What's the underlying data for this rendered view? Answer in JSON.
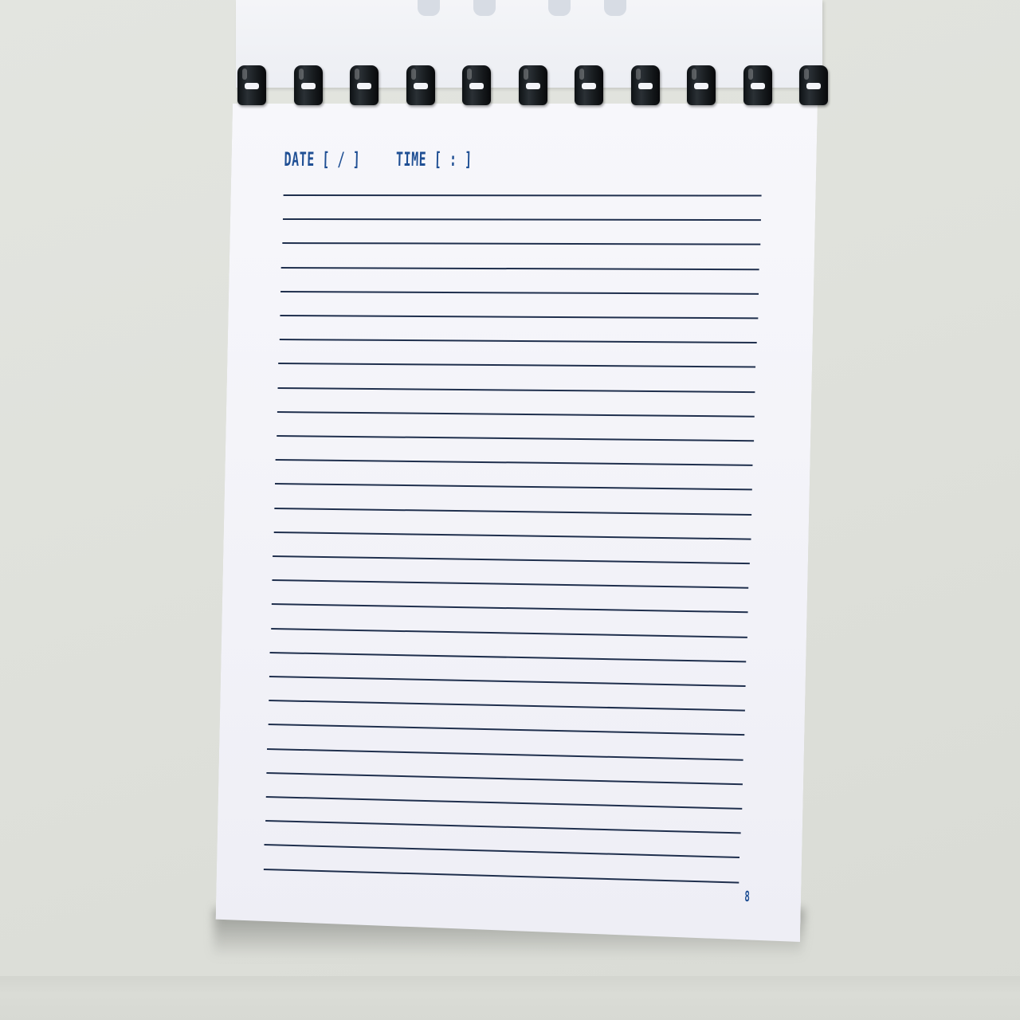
{
  "notebook": {
    "header": {
      "date_label": "DATE",
      "date_brackets": "[ / ]",
      "time_label": "TIME",
      "time_brackets": "[ : ]"
    },
    "page_number": "8",
    "ruled_line_count": 29,
    "binding_ring_count": 11
  },
  "colors": {
    "ink_blue": "#1f4f94",
    "rule_navy": "#1f2f4d",
    "binding_black": "#111417",
    "paper": "#f4f4f9",
    "background": "#dfe1db"
  }
}
